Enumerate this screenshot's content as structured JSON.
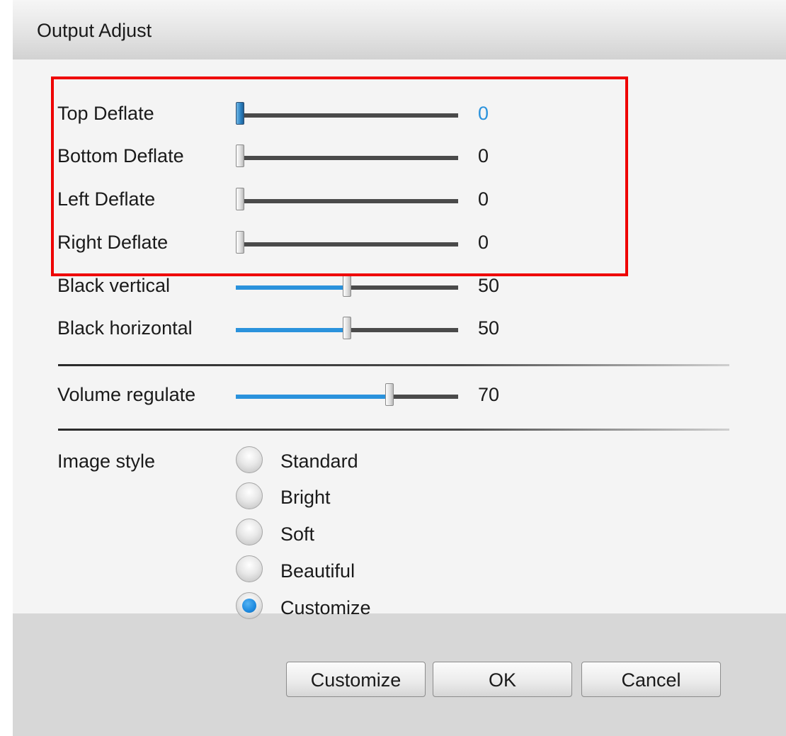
{
  "dialog": {
    "title": "Output Adjust"
  },
  "sliders": [
    {
      "label": "Top Deflate",
      "value": "0",
      "level": 0.0,
      "active": true
    },
    {
      "label": "Bottom Deflate",
      "value": "0",
      "level": 0.0,
      "active": false
    },
    {
      "label": "Left Deflate",
      "value": "0",
      "level": 0.0,
      "active": false
    },
    {
      "label": "Right Deflate",
      "value": "0",
      "level": 0.0,
      "active": false
    },
    {
      "label": "Black vertical",
      "value": "50",
      "level": 0.5,
      "active": false
    },
    {
      "label": "Black horizontal",
      "value": "50",
      "level": 0.5,
      "active": false
    },
    {
      "label": "Volume regulate",
      "value": "70",
      "level": 0.7,
      "active": false
    }
  ],
  "image_style": {
    "label": "Image style",
    "selected": "Customize",
    "options": [
      "Standard",
      "Bright",
      "Soft",
      "Beautiful",
      "Customize"
    ]
  },
  "buttons": {
    "customize": "Customize",
    "ok": "OK",
    "cancel": "Cancel"
  },
  "colors": {
    "accent": "#2a92dc",
    "highlight_box": "#ee0000",
    "track": "#4a4a4a"
  }
}
